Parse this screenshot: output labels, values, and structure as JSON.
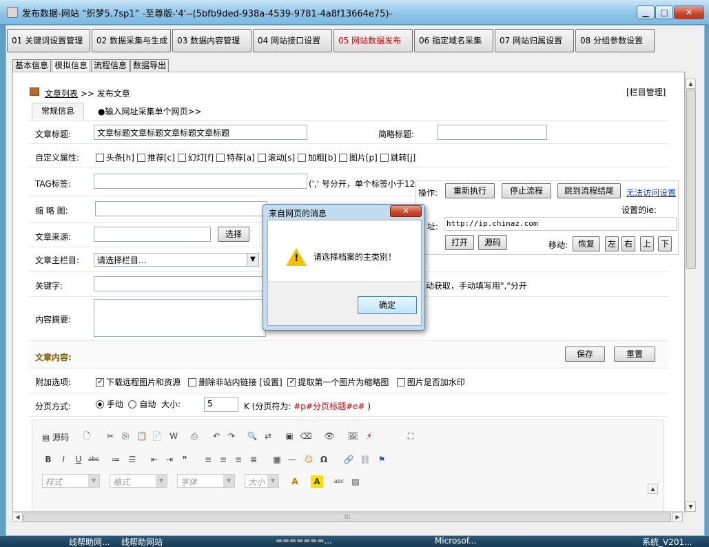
{
  "window": {
    "title": "发布数据-网站 “织梦5.7sp1” -至尊版-'4'--(5bfb9ded-938a-4539-9781-4a8f13664e75)-",
    "min_label": "▁",
    "max_label": "□",
    "close_label": "✕"
  },
  "top_nav": [
    {
      "label": "01 关键词设置管理"
    },
    {
      "label": "02 数据采集与生成"
    },
    {
      "label": "03 数据内容管理"
    },
    {
      "label": "04 网站接口设置"
    },
    {
      "label": "05 网站数据发布"
    },
    {
      "label": "06 指定域名采集"
    },
    {
      "label": "07 网站归属设置"
    },
    {
      "label": "08 分组参数设置"
    }
  ],
  "sub_tabs": [
    {
      "label": "基本信息"
    },
    {
      "label": "模拟信息"
    },
    {
      "label": "流程信息"
    },
    {
      "label": "数据导出"
    }
  ],
  "breadcrumb": {
    "list_link": "文章列表",
    "sep": ">>",
    "current": "发布文章"
  },
  "column_manage": "[栏目管理]",
  "form_tabs": {
    "normal": "常规信息",
    "url_collect": "●输入网址采集单个网页>>"
  },
  "form": {
    "title_label": "文章标题:",
    "title_value": "文章标题文章标题文章标题文章标题",
    "short_title_label": "简略标题:",
    "custom_attr_label": "自定义属性:",
    "attrs": [
      "头条[h]",
      "推荐[c]",
      "幻灯[f]",
      "特荐[a]",
      "滚动[s]",
      "加粗[b]",
      "图片[p]",
      "跳转[j]"
    ],
    "tag_label": "TAG标签:",
    "tag_hint": "(',' 号分开，单个标签小于12",
    "thumb_label": "缩 略 图:",
    "source_label": "文章来源:",
    "source_btn": "选择",
    "column_label": "文章主栏目:",
    "column_value": "请选择栏目...",
    "keyword_label": "关键字:",
    "keyword_hint": "动获取，手动填写用\",\"分开",
    "summary_label": "内容摘要:",
    "content_label": "文章内容:",
    "save_btn": "保存",
    "reset_btn": "重置",
    "extra_label": "附加选项:",
    "extras": [
      {
        "label": "下载远程图片和资源",
        "checked": true
      },
      {
        "label": "删除非站内链接",
        "checked": false
      },
      {
        "label": "[设置]",
        "checked": null
      },
      {
        "label": "提取第一个图片为缩略图",
        "checked": true
      },
      {
        "label": "图片是否加水印",
        "checked": false
      }
    ],
    "paging_label": "分页方式:",
    "paging_manual": "手动",
    "paging_auto": "自动",
    "size_label": "大小:",
    "size_value": "5",
    "paging_hint": "K (分页符为:",
    "paging_sep": "#p#分页标题#e#",
    "paging_end": ")"
  },
  "editor": {
    "source_label": "源码",
    "style_ph": "样式",
    "format_ph": "格式",
    "font_ph": "字体",
    "size_ph": "大小"
  },
  "ops_panel": {
    "ops_label": "操作:",
    "rerun": "重新执行",
    "stop": "停止流程",
    "jump_end": "跳到流程结尾",
    "no_access": "无法访问设置",
    "ie_setting": "设置的ie:",
    "addr_label": "址:",
    "url": "http://ip.chinaz.com",
    "open_btn": "打开",
    "source_btn": "源码",
    "move_label": "移动:",
    "restore": "恢复",
    "left": "左",
    "right": "右",
    "up": "上",
    "down": "下"
  },
  "dialog": {
    "title": "来自网页的消息",
    "message": "请选择档案的主类别！",
    "ok": "确定",
    "warning_mark": "!"
  },
  "taskbar": {
    "items": [
      "线帮助网...",
      "线帮助网站",
      "=======...",
      "Microsof...",
      "系统_V201..."
    ]
  },
  "scroll": {
    "up": "▲",
    "down": "▼",
    "left": "◀",
    "right": "▶",
    "grip": "⁞⁞⁞"
  }
}
